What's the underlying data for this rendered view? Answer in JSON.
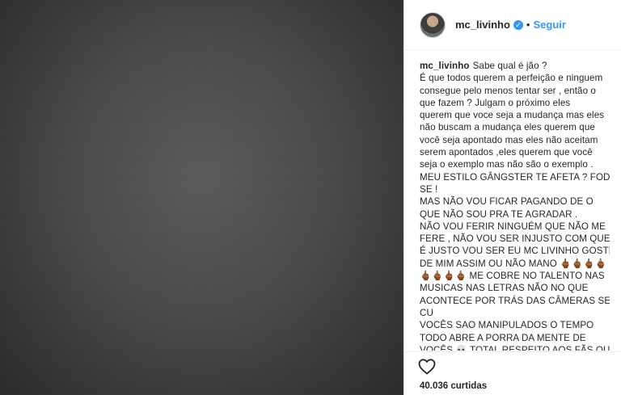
{
  "post": {
    "username": "mc_livinho",
    "follow_label": "Seguir",
    "separator": "•",
    "verified_mark": "✓",
    "likes": "40.036 curtidas"
  },
  "caption": {
    "first_line_text": "Sabe qual é jão ?",
    "lines": [
      "É que todos querem a perfeição e ninguem",
      "consegue pelo menos tentar ser , então o",
      "que fazem ? Julgam o próximo eles",
      "querem que voce seja a mudança mas eles",
      "não buscam a mudança eles querem que",
      "você seja apontado mas eles não aceitam",
      "serem apontados ,eles querem que você",
      "seja o exemplo mas não são o exemplo .",
      "MEU ESTILO GÂNGSTER TE AFETA ? FODA -",
      "SE !",
      "MAS NÃO VOU FICAR PAGANDO DE O",
      "QUE NÃO SOU PRA TE AGRADAR .",
      "NÃO VOU FERIR NINGUÉM QUE NÃO ME",
      "FERE , NÃO VOU SER INJUSTO COM QUEM",
      "É JUSTO VOU SER EU MC LIVINHO GOSTE",
      "DE MIM ASSIM OU NÃO MANO 🖕🏾🖕🏾🖕🏾🖕🏾",
      "🖕🏾🖕🏾🖕🏾🖕🏾 ME COBRE NO TALENTO NAS",
      "MUSICAS NAS LETRAS NÃO NO QUE",
      "ACONTECE POR TRÁS DAS CÂMERAS SEUS",
      "CU",
      "VOCÊS SAO MANIPULADOS O TEMPO",
      "TODO ABRE A PORRA DA MENTE DE",
      "VOCÊS 💀 TOTAL RESPEITO AOS FÃS QUE"
    ]
  },
  "icons": {
    "avatar": "avatar",
    "verified": "verified-badge-icon",
    "like": "heart-icon"
  },
  "colors": {
    "accent": "#3897f0",
    "text": "#262626",
    "border": "#efefef",
    "photo_bg": "#4a4a4a"
  }
}
